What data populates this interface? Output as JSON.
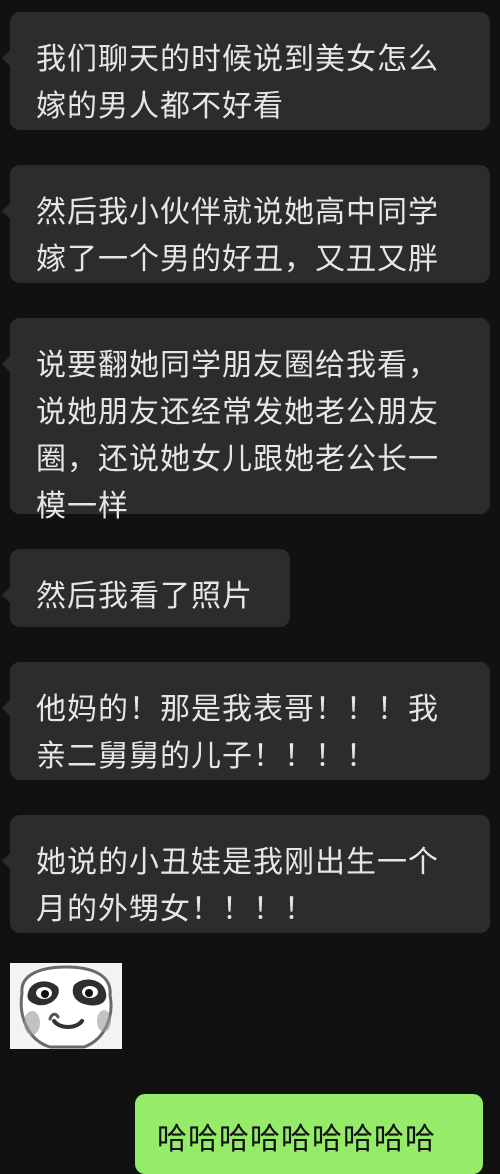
{
  "messages": [
    {
      "side": "left",
      "text": "我们聊天的时候说到美女怎么嫁的男人都不好看"
    },
    {
      "side": "left",
      "text": "然后我小伙伴就说她高中同学嫁了一个男的好丑，又丑又胖"
    },
    {
      "side": "left",
      "text": "说要翻她同学朋友圈给我看，说她朋友还经常发她老公朋友圈，还说她女儿跟她老公长一模一样"
    },
    {
      "side": "left",
      "text": "然后我看了照片"
    },
    {
      "side": "left",
      "text": "他妈的！那是我表哥！！！我亲二舅舅的儿子！！！！"
    },
    {
      "side": "left",
      "text": "她说的小丑娃是我刚出生一个月的外甥女！！！！"
    }
  ],
  "sticker": {
    "icon": "panda-face-sticker-icon"
  },
  "my_message": {
    "side": "right",
    "text": "哈哈哈哈哈哈哈哈哈"
  },
  "colors": {
    "background": "#111111",
    "incoming_bubble": "#2c2c2c",
    "outgoing_bubble": "#95ec69"
  }
}
